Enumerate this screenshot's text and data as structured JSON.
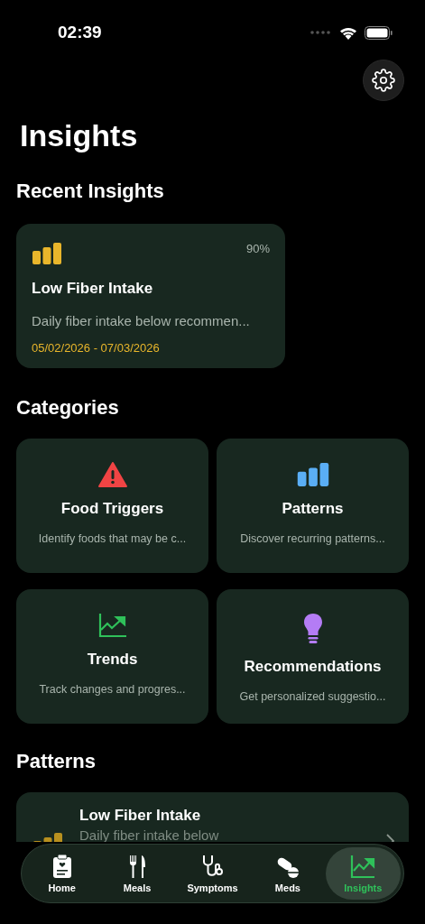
{
  "status_bar": {
    "time": "02:39"
  },
  "title": "Insights",
  "recent": {
    "heading": "Recent Insights",
    "items": [
      {
        "kind": "bars",
        "confidence": "90%",
        "title": "Low Fiber Intake",
        "description": "Daily fiber intake below recommen...",
        "dates": "05/02/2026 - 07/03/2026"
      }
    ]
  },
  "categories": {
    "heading": "Categories",
    "items": [
      {
        "kind": "warning",
        "color": "#f04444",
        "title": "Food Triggers",
        "description": "Identify foods that may be c..."
      },
      {
        "kind": "bars",
        "color": "#5aaef5",
        "title": "Patterns",
        "description": "Discover recurring patterns..."
      },
      {
        "kind": "trend",
        "color": "#2fc15a",
        "title": "Trends",
        "description": "Track changes and progres..."
      },
      {
        "kind": "bulb",
        "color": "#b47cf5",
        "title": "Recommendations",
        "description": "Get personalized suggestio..."
      }
    ]
  },
  "patterns": {
    "heading": "Patterns",
    "items": [
      {
        "title": "Low Fiber Intake",
        "description": "Daily fiber intake below"
      }
    ]
  },
  "tab_bar": [
    {
      "kind": "clipboard",
      "label": "Home",
      "selected": false
    },
    {
      "kind": "fork",
      "label": "Meals",
      "selected": false
    },
    {
      "kind": "stethoscope",
      "label": "Symptoms",
      "selected": false
    },
    {
      "kind": "pills",
      "label": "Meds",
      "selected": false
    },
    {
      "kind": "trend",
      "label": "Insights",
      "selected": true
    }
  ]
}
